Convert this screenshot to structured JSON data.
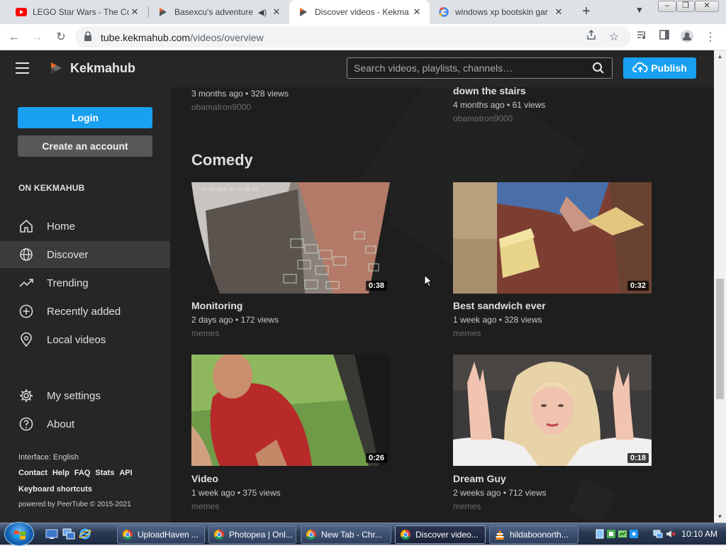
{
  "browser": {
    "tabs": [
      {
        "title": "LEGO Star Wars - The Co",
        "favicon": "youtube-icon",
        "active": false
      },
      {
        "title": "Basexcu's adventure",
        "favicon": "kekmahub-icon",
        "active": false,
        "audio": true
      },
      {
        "title": "Discover videos - Kekma",
        "favicon": "kekmahub-icon",
        "active": true
      },
      {
        "title": "windows xp bootskin gar",
        "favicon": "google-icon",
        "active": false
      }
    ],
    "url_host": "tube.kekmahub.com",
    "url_path": "/videos/overview"
  },
  "header": {
    "brand": "Kekmahub",
    "search_placeholder": "Search videos, playlists, channels…",
    "publish_label": "Publish"
  },
  "sidebar": {
    "login_label": "Login",
    "create_label": "Create an account",
    "section_label": "ON KEKMAHUB",
    "items": [
      {
        "label": "Home",
        "icon": "home-icon"
      },
      {
        "label": "Discover",
        "icon": "globe-icon",
        "active": true
      },
      {
        "label": "Trending",
        "icon": "trending-icon"
      },
      {
        "label": "Recently added",
        "icon": "plus-circle-icon"
      },
      {
        "label": "Local videos",
        "icon": "location-icon"
      }
    ],
    "items2": [
      {
        "label": "My settings",
        "icon": "gear-icon"
      },
      {
        "label": "About",
        "icon": "help-icon"
      }
    ],
    "interface_label": "Interface: English",
    "links": [
      "Contact",
      "Help",
      "FAQ",
      "Stats",
      "API"
    ],
    "shortcuts_label": "Keyboard shortcuts",
    "powered": "powered by PeerTube © 2015-2021"
  },
  "content": {
    "top_videos": [
      {
        "title": "",
        "meta": "3 months ago • 328 views",
        "channel": "obamatron9000"
      },
      {
        "title": "down the stairs",
        "meta": "4 months ago • 61 views",
        "channel": "obamatron9000"
      }
    ],
    "section_title": "Comedy",
    "videos": [
      {
        "title": "Monitoring",
        "meta": "2 days ago • 172 views",
        "channel": "memes",
        "duration": "0:38"
      },
      {
        "title": "Best sandwich ever",
        "meta": "1 week ago • 328 views",
        "channel": "memes",
        "duration": "0:32"
      },
      {
        "title": "Video",
        "meta": "1 week ago • 375 views",
        "channel": "memes",
        "duration": "0:26"
      },
      {
        "title": "Dream Guy",
        "meta": "2 weeks ago • 712 views",
        "channel": "memes",
        "duration": "0:18"
      }
    ]
  },
  "taskbar": {
    "buttons": [
      {
        "label": "UploadHaven ...",
        "icon": "chrome-icon"
      },
      {
        "label": "Photopea | Onl...",
        "icon": "chrome-icon"
      },
      {
        "label": "New Tab - Chr...",
        "icon": "chrome-icon"
      },
      {
        "label": "Discover video...",
        "icon": "chrome-icon",
        "active": true
      },
      {
        "label": "hildaboonorth...",
        "icon": "vlc-icon"
      }
    ],
    "clock": "10:10 AM"
  },
  "colors": {
    "accent": "#1aa0f0",
    "page_bg": "#1e1e1e",
    "panel_bg": "#262626"
  }
}
